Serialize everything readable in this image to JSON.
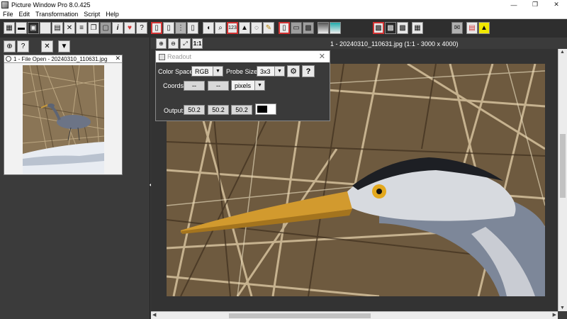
{
  "window": {
    "title": "Picture Window Pro 8.0.425",
    "minimize": "—",
    "maximize": "❐",
    "close": "✕"
  },
  "menu": [
    "File",
    "Edit",
    "Transformation",
    "Script",
    "Help"
  ],
  "toolbar_icons": [
    "new-icon",
    "open-icon",
    "save-icon",
    "blank-icon",
    "print-icon",
    "close-icon",
    "list-icon",
    "copy-icon",
    "paste-icon",
    "info-icon",
    "favorite-icon",
    "help-icon"
  ],
  "side_buttons": {
    "zoom_in": "⊕",
    "help": "?",
    "collapse": "✕",
    "dropdown": "▼"
  },
  "thumbnail": {
    "title": "1 - File Open - 20240310_110631.jpg",
    "close": "✕"
  },
  "image_window": {
    "title": "1 - 20240310_110631.jpg (1:1 - 3000 x 4000)",
    "one_to_one": "1:1"
  },
  "readout": {
    "title": "Readout",
    "color_space_label": "Color Space:",
    "color_space_value": "RGB",
    "probe_size_label": "Probe Size:",
    "probe_size_value": "3x3",
    "coords_label": "Coords:",
    "coord_x": "--",
    "coord_y": "--",
    "coord_units": "pixels",
    "output_label": "Output:",
    "output_r": "50.2",
    "output_g": "50.2",
    "output_b": "50.2",
    "help": "?"
  },
  "colors": {
    "accent_red": "#d23434",
    "toolbar_bg": "#2e2e2e",
    "panel_bg": "#3b3b3b"
  }
}
